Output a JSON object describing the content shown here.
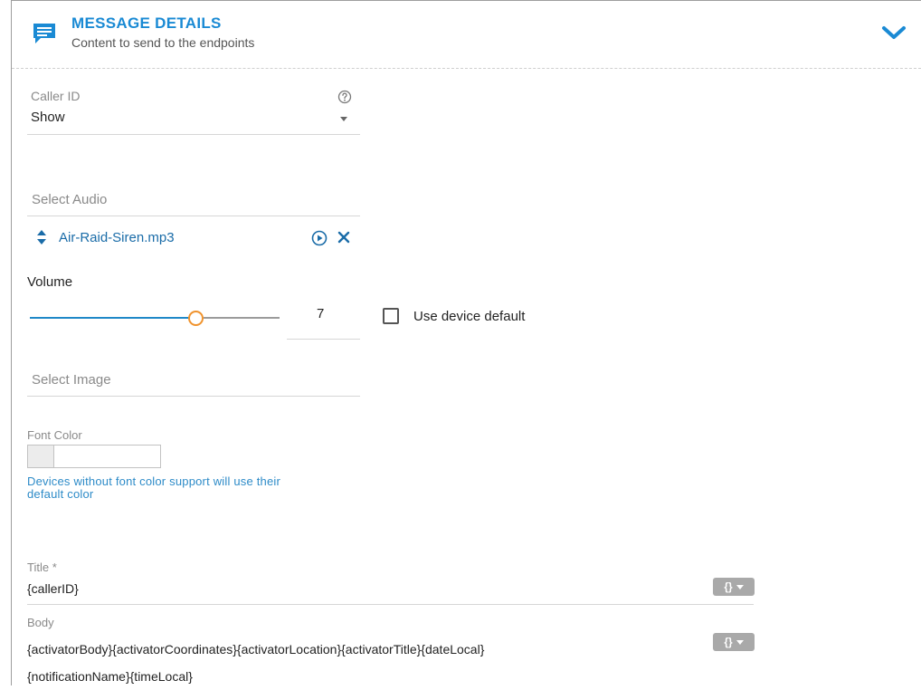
{
  "header": {
    "title": "MESSAGE DETAILS",
    "subtitle": "Content to send to the endpoints",
    "icon": "message-icon",
    "accent": "#1a8ad4"
  },
  "caller_id": {
    "label": "Caller ID",
    "value": "Show"
  },
  "audio": {
    "placeholder": "Select Audio",
    "selected_file": "Air-Raid-Siren.mp3"
  },
  "volume": {
    "label": "Volume",
    "value": "7",
    "level_fraction": 0.7,
    "use_default_label": "Use device default",
    "use_default_checked": false
  },
  "image": {
    "placeholder": "Select Image"
  },
  "font_color": {
    "label": "Font Color",
    "hint_line1": "Devices without font color support will use their",
    "hint_line2": "default color"
  },
  "title_field": {
    "label": "Title *",
    "value": "{callerID}",
    "token_button": "{}"
  },
  "body_field": {
    "label": "Body",
    "line1": "{activatorBody}{activatorCoordinates}{activatorLocation}{activatorTitle}{dateLocal}",
    "line2": "{notificationName}{timeLocal}",
    "token_button": "{}"
  }
}
